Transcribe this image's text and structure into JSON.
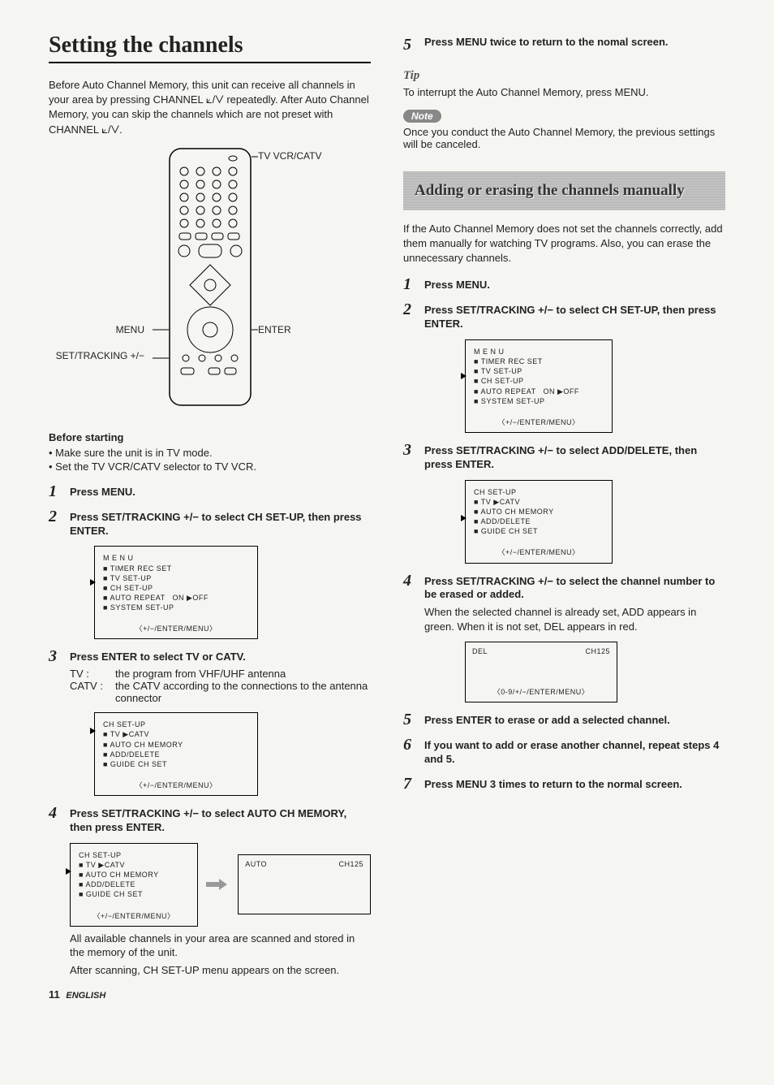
{
  "title": "Setting the channels",
  "intro_lines": [
    "Before Auto Channel Memory, this unit can receive all channels in your area by pressing CHANNEL ⟀/⋁ repeatedly. After Auto Channel Memory, you can skip the channels which are not preset with CHANNEL ⟀/⋁."
  ],
  "remote_labels": {
    "tv_vcr_catv": "TV VCR/CATV",
    "menu": "MENU",
    "enter": "ENTER",
    "set_tracking": "SET/TRACKING +/−"
  },
  "before_starting": {
    "heading": "Before starting",
    "items": [
      "Make sure the unit is in TV mode.",
      "Set the TV VCR/CATV selector to TV VCR."
    ]
  },
  "left_steps": [
    {
      "title": "Press MENU."
    },
    {
      "title": "Press SET/TRACKING +/− to select CH SET-UP, then press ENTER.",
      "menu": {
        "title": "M E N U",
        "lines": [
          "■ TIMER REC SET",
          "■ TV SET-UP",
          "■ CH SET-UP",
          "■ AUTO REPEAT   ON ▶OFF",
          "■ SYSTEM SET-UP"
        ],
        "footer": "〈+/−/ENTER/MENU〉",
        "cursor_index": 2
      }
    },
    {
      "title": "Press ENTER to select TV or CATV.",
      "defs": [
        {
          "label": "TV :",
          "text": "the program from VHF/UHF antenna"
        },
        {
          "label": "CATV :",
          "text": "the CATV according to the connections to the antenna connector"
        }
      ],
      "menu": {
        "title": "CH SET-UP",
        "lines": [
          "■ TV ▶CATV",
          "■ AUTO CH MEMORY",
          "■ ADD/DELETE",
          "■ GUIDE CH SET"
        ],
        "footer": "〈+/−/ENTER/MENU〉",
        "cursor_index": 0
      }
    },
    {
      "title": "Press SET/TRACKING +/− to select AUTO CH MEMORY, then press ENTER.",
      "dual": {
        "left_menu": {
          "title": "CH SET-UP",
          "lines": [
            "■ TV ▶CATV",
            "■ AUTO CH MEMORY",
            "■ ADD/DELETE",
            "■ GUIDE CH SET"
          ],
          "footer": "〈+/−/ENTER/MENU〉",
          "cursor_index": 1
        },
        "right_status": {
          "left": "AUTO",
          "right": "CH125"
        }
      },
      "after": [
        "All available channels in your area are scanned and stored in the memory of the unit.",
        "After scanning, CH SET-UP menu appears on the screen."
      ]
    }
  ],
  "right_top_step": {
    "num": "5",
    "title": "Press MENU twice to return to the nomal screen."
  },
  "tip": {
    "label": "Tip",
    "text": "To interrupt the Auto Channel Memory, press MENU."
  },
  "note": {
    "label": "Note",
    "text": "Once you conduct the Auto Channel Memory, the previous settings will be canceled."
  },
  "section2": {
    "heading": "Adding or erasing the channels manually",
    "intro": "If the Auto Channel Memory does not set the channels correctly, add them manually for watching TV programs. Also, you can erase the unnecessary channels.",
    "steps": [
      {
        "title": "Press MENU."
      },
      {
        "title": "Press SET/TRACKING +/− to select CH SET-UP, then press ENTER.",
        "menu": {
          "title": "M E N U",
          "lines": [
            "■ TIMER REC SET",
            "■ TV SET-UP",
            "■ CH SET-UP",
            "■ AUTO REPEAT   ON ▶OFF",
            "■ SYSTEM SET-UP"
          ],
          "footer": "〈+/−/ENTER/MENU〉",
          "cursor_index": 2
        }
      },
      {
        "title": "Press SET/TRACKING +/− to select ADD/DELETE, then press ENTER.",
        "menu": {
          "title": "CH SET-UP",
          "lines": [
            "■ TV ▶CATV",
            "■ AUTO CH MEMORY",
            "■ ADD/DELETE",
            "■ GUIDE CH SET"
          ],
          "footer": "〈+/−/ENTER/MENU〉",
          "cursor_index": 2
        }
      },
      {
        "title": "Press SET/TRACKING +/− to select the channel number to be erased or added.",
        "body": "When the selected channel is already set, ADD appears in green. When it is not set, DEL appears in red.",
        "status": {
          "left": "DEL",
          "right": "CH125",
          "footer": "〈0-9/+/−/ENTER/MENU〉"
        }
      },
      {
        "title": "Press ENTER to erase or add a selected channel."
      },
      {
        "title": "If you want to add or erase another channel, repeat steps 4 and 5."
      },
      {
        "title": "Press MENU 3 times to return to the normal screen."
      }
    ]
  },
  "footer": {
    "page": "11",
    "lang": "ENGLISH"
  }
}
